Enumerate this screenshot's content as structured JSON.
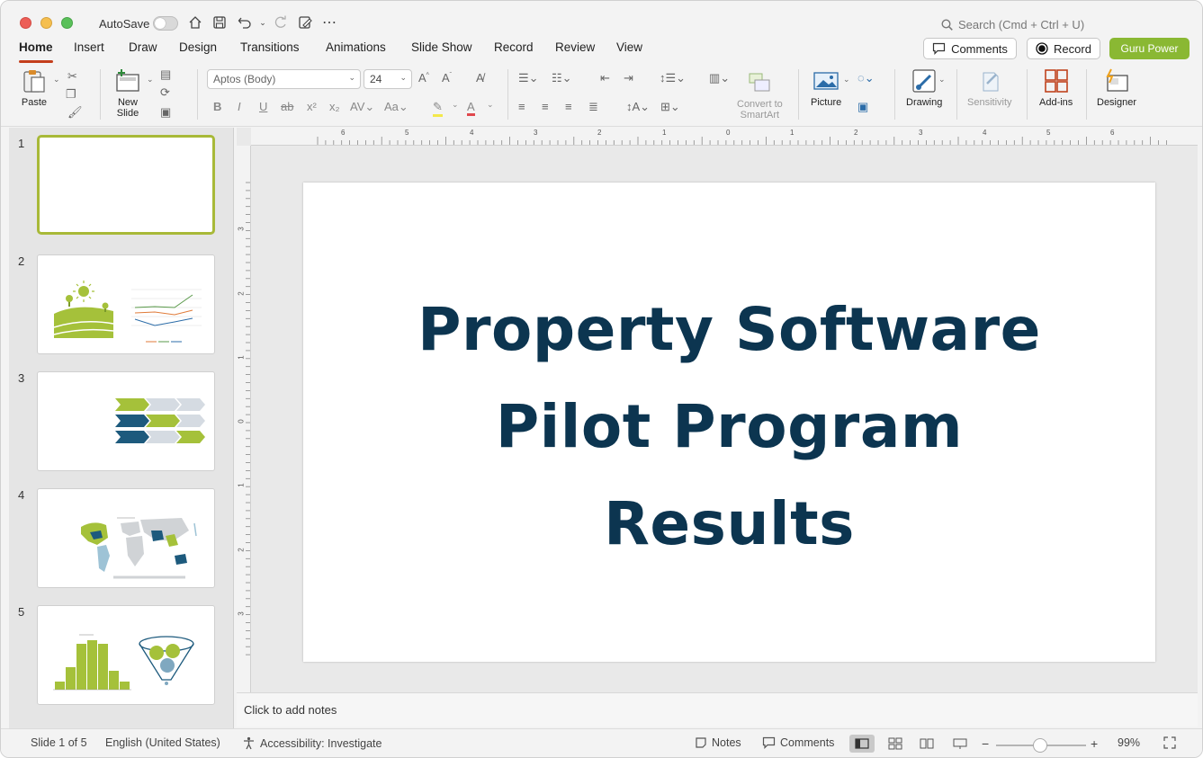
{
  "titlebar": {
    "autosave_label": "AutoSave",
    "search_placeholder": "Search (Cmd + Ctrl + U)"
  },
  "tabs": [
    {
      "label": "Home"
    },
    {
      "label": "Insert"
    },
    {
      "label": "Draw"
    },
    {
      "label": "Design"
    },
    {
      "label": "Transitions"
    },
    {
      "label": "Animations"
    },
    {
      "label": "Slide Show"
    },
    {
      "label": "Record"
    },
    {
      "label": "Review"
    },
    {
      "label": "View"
    }
  ],
  "header_buttons": {
    "comments": "Comments",
    "record": "Record",
    "guru": "Guru Power"
  },
  "ribbon": {
    "paste": "Paste",
    "new_slide_1": "New",
    "new_slide_2": "Slide",
    "font_name": "Aptos (Body)",
    "font_size": "24",
    "convert_1": "Convert to",
    "convert_2": "SmartArt",
    "picture": "Picture",
    "drawing": "Drawing",
    "sensitivity": "Sensitivity",
    "addins": "Add-ins",
    "designer": "Designer"
  },
  "ruler": {
    "h_labels": [
      "6",
      "5",
      "4",
      "3",
      "2",
      "1",
      "0",
      "1",
      "2",
      "3",
      "4",
      "5",
      "6"
    ],
    "v_labels": [
      "3",
      "2",
      "1",
      "0",
      "1",
      "2",
      "3"
    ]
  },
  "thumbnails": [
    {
      "num": "1"
    },
    {
      "num": "2"
    },
    {
      "num": "3"
    },
    {
      "num": "4"
    },
    {
      "num": "5"
    }
  ],
  "slide": {
    "title_line1": "Property Software",
    "title_line2": "Pilot Program",
    "title_line3": "Results"
  },
  "notes_placeholder": "Click to add notes",
  "status": {
    "slide_info": "Slide 1 of 5",
    "language": "English (United States)",
    "accessibility": "Accessibility: Investigate",
    "notes": "Notes",
    "comments": "Comments",
    "zoom": "99%"
  },
  "colors": {
    "accent_red": "#c43e1c",
    "guru_green": "#8ab833",
    "title_navy": "#0c3550",
    "thumb_green": "#a5c13a",
    "thumb_blue": "#1d5a7d"
  }
}
